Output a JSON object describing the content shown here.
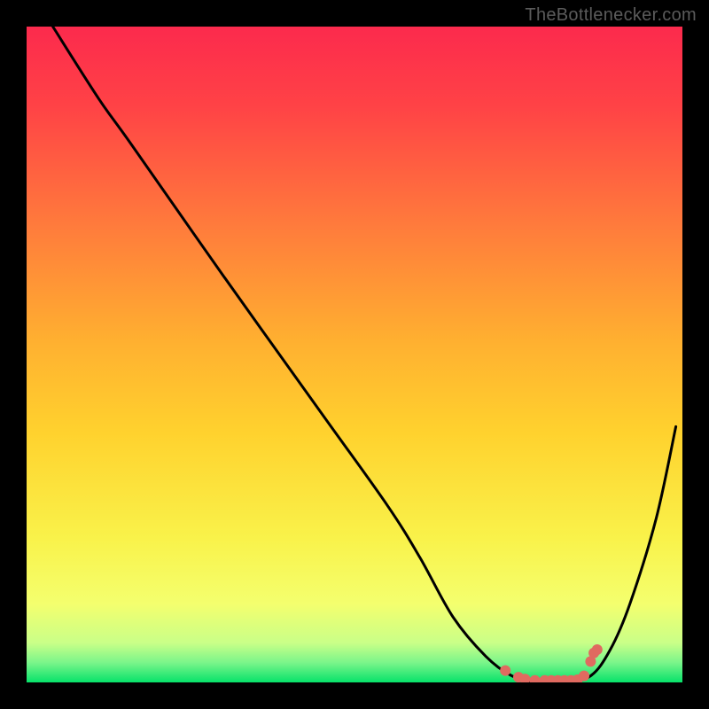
{
  "watermark": "TheBottlenecker.com",
  "chart_data": {
    "type": "line",
    "title": "",
    "xlabel": "",
    "ylabel": "",
    "xlim": [
      0,
      100
    ],
    "ylim": [
      0,
      100
    ],
    "series": [
      {
        "name": "curve",
        "x": [
          4,
          11,
          16,
          30,
          45,
          55,
          60,
          65,
          70,
          74,
          78,
          82,
          86,
          89,
          92,
          96,
          99
        ],
        "y": [
          100,
          89,
          82,
          62,
          41,
          27,
          19,
          10,
          4,
          1,
          0,
          0,
          1,
          5,
          12,
          25,
          39
        ]
      }
    ],
    "highlight_dots": {
      "x": [
        73,
        75,
        76,
        77.5,
        79,
        80,
        81,
        82,
        83,
        84,
        85,
        86,
        86.5,
        87
      ],
      "y": [
        1.8,
        0.8,
        0.5,
        0.3,
        0.3,
        0.3,
        0.3,
        0.3,
        0.3,
        0.4,
        1.0,
        3.2,
        4.5,
        5.0
      ]
    },
    "gradient_colors": {
      "top": "#fc2a4d",
      "upper_mid": "#ff7a3c",
      "mid": "#ffd22e",
      "lower_mid": "#f7ff5e",
      "near_bottom": "#d2ff85",
      "bottom": "#07e26a"
    }
  }
}
